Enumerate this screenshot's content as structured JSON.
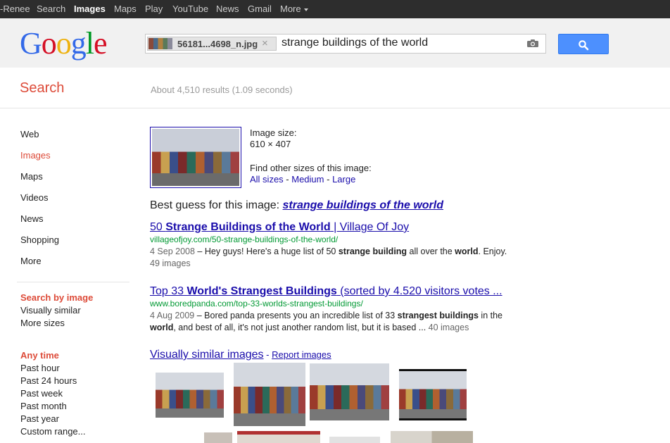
{
  "topbar": {
    "items": [
      "-Renee",
      "Search",
      "Images",
      "Maps",
      "Play",
      "YouTube",
      "News",
      "Gmail",
      "More"
    ],
    "active": "Images"
  },
  "header": {
    "logo": [
      "G",
      "o",
      "o",
      "g",
      "l",
      "e"
    ],
    "logo_colors": [
      "#3369e8",
      "#d50f25",
      "#eeb211",
      "#3369e8",
      "#009925",
      "#d50f25"
    ],
    "chip_filename": "56181...4698_n.jpg",
    "chip_close": "×",
    "query": "strange buildings of the world",
    "camera_icon": "camera-icon",
    "search_button_icon": "magnifier-icon",
    "search_button_color": "#4d90fe"
  },
  "subheader": {
    "label": "Search",
    "stats": "About 4,510 results (1.09 seconds)"
  },
  "sidebar": {
    "items": [
      "Web",
      "Images",
      "Maps",
      "Videos",
      "News",
      "Shopping",
      "More"
    ],
    "active": "Images",
    "search_by_image": {
      "title": "Search by image",
      "items": [
        "Visually similar",
        "More sizes"
      ]
    },
    "any_time": {
      "title": "Any time",
      "items": [
        "Past hour",
        "Past 24 hours",
        "Past week",
        "Past month",
        "Past year",
        "Custom range..."
      ]
    }
  },
  "image_info": {
    "size_label": "Image size:",
    "size_value": "610 × 407",
    "other_sizes_label": "Find other sizes of this image:",
    "sizes": [
      "All sizes",
      "Medium",
      "Large"
    ],
    "separator": " - "
  },
  "best_guess": {
    "label": "Best guess for this image: ",
    "value": "strange buildings of the world"
  },
  "results": [
    {
      "title_pre": "50 ",
      "title_bold": "Strange Buildings of the World",
      "title_post": " | Village Of Joy",
      "url": "villageofjoy.com/50-strange-buildings-of-the-world/",
      "date": "4 Sep 2008",
      "snippet": " – Hey guys! Here's a huge list of 50 ",
      "snippet_b1": "strange building",
      "snippet_mid": " all over the ",
      "snippet_b2": "world",
      "snippet_end": ". Enjoy.",
      "meta": " 49 images"
    },
    {
      "title_pre": "Top 33 ",
      "title_bold": "World's Strangest Buildings",
      "title_post": " (sorted by 4.520 visitors votes ...",
      "url": "www.boredpanda.com/top-33-worlds-strangest-buildings/",
      "date": "4 Aug 2009",
      "snippet": " – Bored panda presents you an incredible list of 33 ",
      "snippet_b1": "strangest buildings",
      "snippet_mid": " in the ",
      "snippet_b2": "world",
      "snippet_end": ", and best of all, it's not just another random list, but it is based ...",
      "meta": " 40 images"
    }
  ],
  "visually_similar": {
    "title": "Visually similar images",
    "sep": " - ",
    "report": "Report images"
  }
}
